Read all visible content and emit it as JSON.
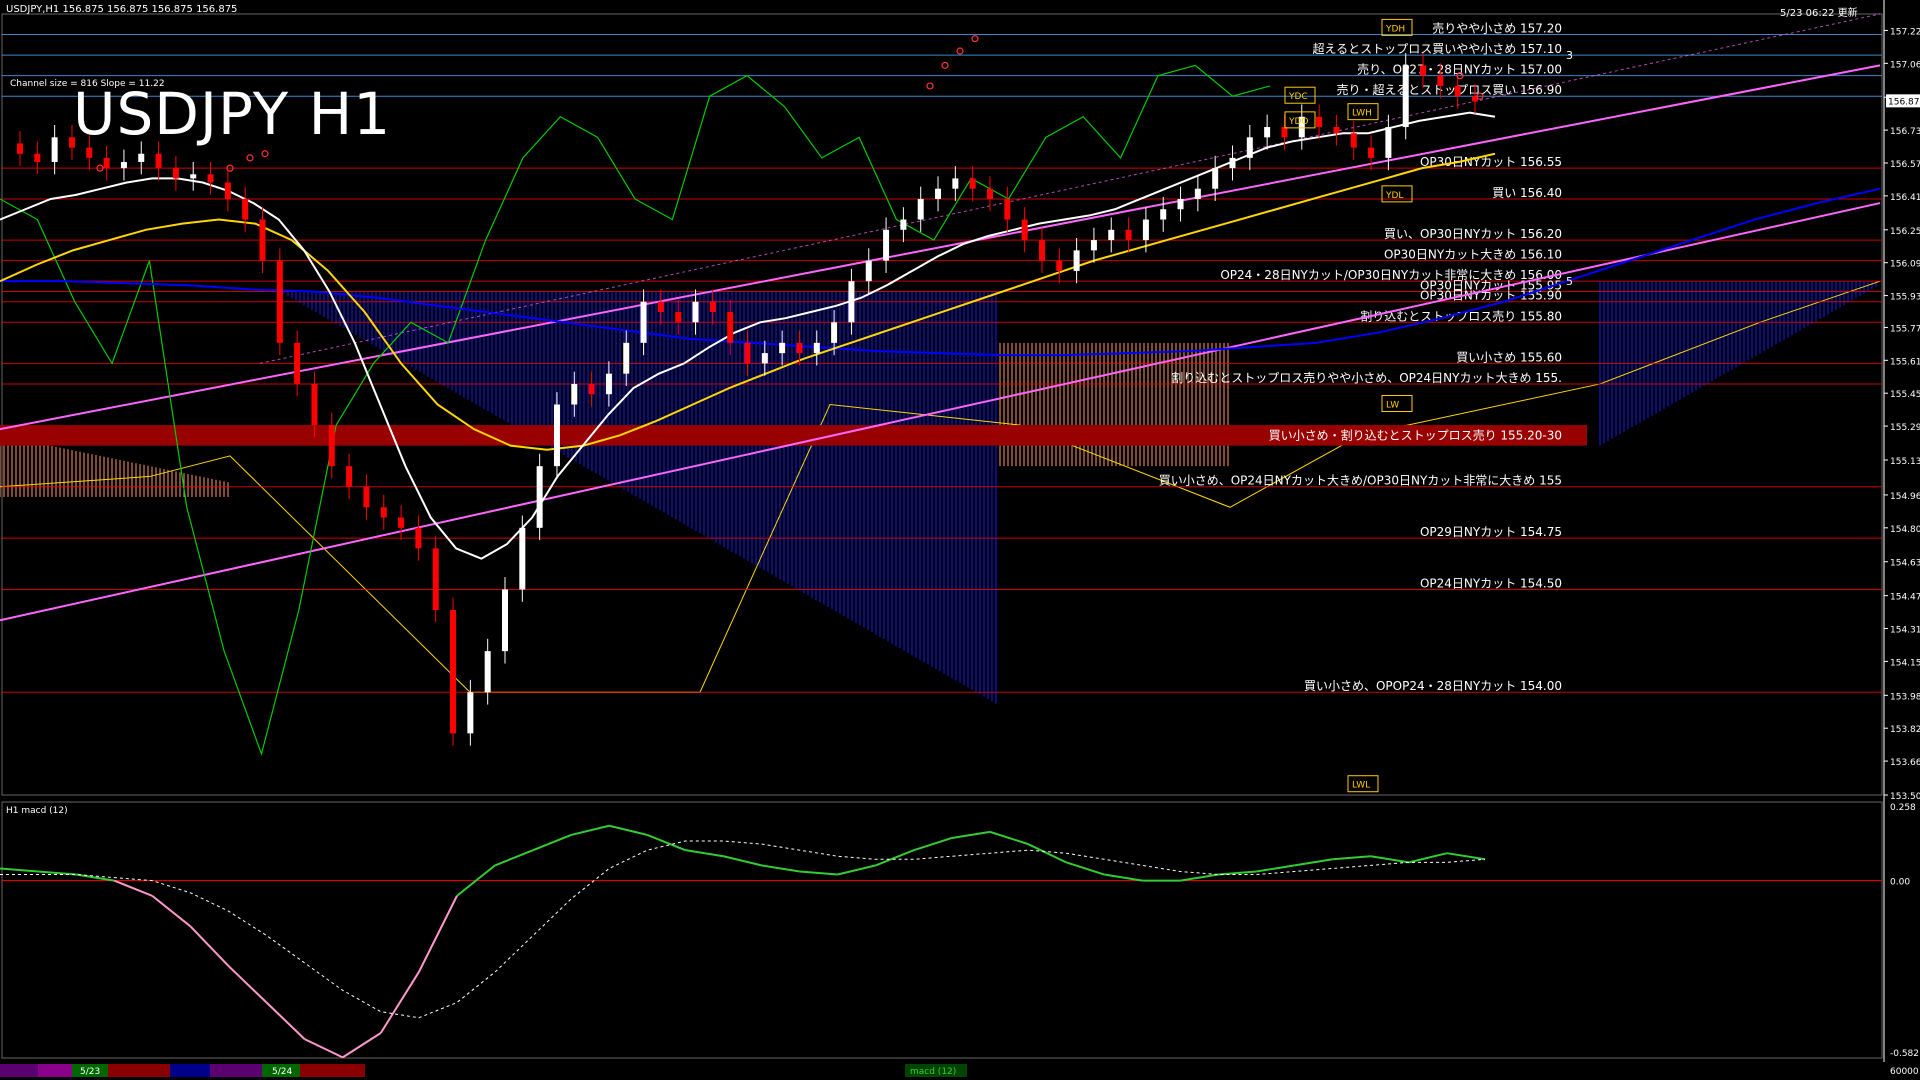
{
  "header": {
    "symbol_info": "USDJPY,H1  156.875 156.875 156.875 156.875",
    "updated": "5/23 06:22 更新",
    "channel_info": "Channel size = 816 Slope = 11.22"
  },
  "title": "USDJPY H1",
  "price_axis": {
    "labels": [
      "157.220",
      "157.060",
      "156.895",
      "156.735",
      "156.575",
      "156.415",
      "156.250",
      "156.090",
      "155.930",
      "155.775",
      "155.615",
      "155.455",
      "155.295",
      "155.130",
      "154.960",
      "154.800",
      "154.635",
      "154.470",
      "154.310",
      "154.150",
      "153.985",
      "153.825",
      "153.665",
      "153.500"
    ],
    "current": "156.875"
  },
  "colors": {
    "resistance_line": "#ff0000",
    "info_line": "#4da6ff",
    "channel": "#ff66ff",
    "sma_fast": "#ffffff",
    "sma_mid": "#ffd700",
    "sma_slow": "#0000ff",
    "chikou": "#00cc00",
    "cloud_bull": "#1a1aff",
    "cloud_bear": "#ff9966",
    "macd_main": "#33cc33",
    "macd_neg": "#ff99cc"
  },
  "chart_data": {
    "type": "candlestick",
    "symbol": "USDJPY",
    "timeframe": "H1",
    "ylim": [
      153.5,
      157.3
    ],
    "levels": [
      {
        "price": 157.2,
        "label": "売りやや小さめ 157.20",
        "color": "info"
      },
      {
        "price": 157.1,
        "label": "超えるとストップロス買いやや小さめ 157.10",
        "color": "info"
      },
      {
        "price": 157.0,
        "label": "売り、OP27・28日NYカット 157.00",
        "color": "info"
      },
      {
        "price": 156.9,
        "label": "売り・超えるとストップロス買い 156.90",
        "color": "info"
      },
      {
        "price": 156.55,
        "label": "OP30日NYカット 156.55",
        "color": "res"
      },
      {
        "price": 156.4,
        "label": "買い 156.40",
        "color": "res"
      },
      {
        "price": 156.2,
        "label": "買い、OP30日NYカット 156.20",
        "color": "res"
      },
      {
        "price": 156.1,
        "label": "OP30日NYカット大きめ 156.10",
        "color": "res"
      },
      {
        "price": 156.0,
        "label": "OP24・28日NYカット/OP30日NYカット非常に大きめ 156.00",
        "color": "res"
      },
      {
        "price": 155.95,
        "label": "OP30日NYカット 155.95",
        "color": "res"
      },
      {
        "price": 155.9,
        "label": "OP30日NYカット 155.90",
        "color": "res"
      },
      {
        "price": 155.8,
        "label": "割り込むとストップロス売り 155.80",
        "color": "res"
      },
      {
        "price": 155.6,
        "label": "買い小さめ 155.60",
        "color": "res"
      },
      {
        "price": 155.5,
        "label": "割り込むとストップロス売りやや小さめ、OP24日NYカット大きめ 155.",
        "color": "res"
      },
      {
        "price": 155.0,
        "label": "買い小さめ、OP24日NYカット大きめ/OP30日NYカット非常に大きめ 155",
        "color": "res"
      },
      {
        "price": 154.75,
        "label": "OP29日NYカット 154.75",
        "color": "res"
      },
      {
        "price": 154.5,
        "label": "OP24日NYカット 154.50",
        "color": "res"
      },
      {
        "price": 154.0,
        "label": "買い小さめ、OPOP24・28日NYカット 154.00",
        "color": "res"
      }
    ],
    "zone": {
      "from": 155.2,
      "to": 155.3,
      "label": "買い小さめ・割り込むとストップロス売り 155.20-30"
    },
    "markers": [
      "YDH",
      "YDC",
      "YDO",
      "LWH",
      "YDL",
      "LWL",
      "LW"
    ],
    "side_numbers": [
      "3",
      "5"
    ],
    "closes": [
      156.62,
      156.58,
      156.7,
      156.65,
      156.6,
      156.55,
      156.58,
      156.62,
      156.55,
      156.5,
      156.52,
      156.48,
      156.4,
      156.3,
      156.1,
      155.7,
      155.5,
      155.3,
      155.1,
      155.0,
      154.9,
      154.85,
      154.8,
      154.7,
      154.4,
      153.8,
      154.0,
      154.2,
      154.5,
      154.8,
      155.1,
      155.4,
      155.5,
      155.45,
      155.55,
      155.7,
      155.9,
      155.85,
      155.8,
      155.9,
      155.85,
      155.7,
      155.6,
      155.65,
      155.7,
      155.65,
      155.7,
      155.8,
      156.0,
      156.1,
      156.25,
      156.3,
      156.4,
      156.45,
      156.5,
      156.45,
      156.4,
      156.3,
      156.2,
      156.1,
      156.05,
      156.15,
      156.2,
      156.25,
      156.2,
      156.3,
      156.35,
      156.4,
      156.45,
      156.55,
      156.6,
      156.7,
      156.75,
      156.7,
      156.8,
      156.75,
      156.72,
      156.65,
      156.6,
      156.75,
      157.05,
      157.0,
      156.95,
      156.9,
      156.875
    ],
    "sma_fast": [
      156.3,
      156.35,
      156.4,
      156.42,
      156.45,
      156.48,
      156.5,
      156.5,
      156.48,
      156.44,
      156.38,
      156.3,
      156.15,
      155.95,
      155.7,
      155.4,
      155.1,
      154.85,
      154.7,
      154.65,
      154.72,
      154.85,
      155.05,
      155.2,
      155.35,
      155.48,
      155.55,
      155.6,
      155.68,
      155.75,
      155.8,
      155.82,
      155.85,
      155.88,
      155.92,
      155.98,
      156.05,
      156.12,
      156.18,
      156.22,
      156.25,
      156.28,
      156.3,
      156.32,
      156.35,
      156.4,
      156.45,
      156.5,
      156.55,
      156.6,
      156.65,
      156.68,
      156.7,
      156.72,
      156.72,
      156.75,
      156.78,
      156.8,
      156.82,
      156.8
    ],
    "sma_mid": [
      156.0,
      156.08,
      156.15,
      156.2,
      156.25,
      156.28,
      156.3,
      156.28,
      156.2,
      156.05,
      155.85,
      155.6,
      155.4,
      155.28,
      155.2,
      155.18,
      155.2,
      155.25,
      155.32,
      155.4,
      155.48,
      155.55,
      155.62,
      155.68,
      155.74,
      155.8,
      155.86,
      155.92,
      155.98,
      156.04,
      156.1,
      156.15,
      156.2,
      156.25,
      156.3,
      156.35,
      156.4,
      156.45,
      156.5,
      156.55,
      156.58,
      156.62
    ],
    "sma_slow": [
      156.0,
      156.0,
      155.99,
      155.98,
      155.96,
      155.95,
      155.92,
      155.88,
      155.84,
      155.8,
      155.76,
      155.72,
      155.7,
      155.68,
      155.66,
      155.65,
      155.64,
      155.64,
      155.65,
      155.66,
      155.68,
      155.7,
      155.75,
      155.82,
      155.9,
      156.0,
      156.1,
      156.2,
      156.3,
      156.38,
      156.45
    ],
    "macd": {
      "label": "H1 macd (12)",
      "ylim": [
        -0.582,
        0.258
      ],
      "zero": 0.0,
      "main": [
        0.04,
        0.03,
        0.02,
        0.0,
        -0.05,
        -0.15,
        -0.28,
        -0.4,
        -0.52,
        -0.58,
        -0.5,
        -0.3,
        -0.05,
        0.05,
        0.1,
        0.15,
        0.18,
        0.15,
        0.1,
        0.08,
        0.05,
        0.03,
        0.02,
        0.05,
        0.1,
        0.14,
        0.16,
        0.12,
        0.06,
        0.02,
        0.0,
        0.0,
        0.02,
        0.03,
        0.05,
        0.07,
        0.08,
        0.06,
        0.09,
        0.07
      ],
      "signal": [
        0.02,
        0.02,
        0.02,
        0.01,
        0.0,
        -0.04,
        -0.1,
        -0.18,
        -0.27,
        -0.36,
        -0.43,
        -0.45,
        -0.4,
        -0.3,
        -0.18,
        -0.06,
        0.04,
        0.1,
        0.13,
        0.13,
        0.12,
        0.1,
        0.08,
        0.07,
        0.07,
        0.08,
        0.09,
        0.1,
        0.09,
        0.07,
        0.05,
        0.03,
        0.02,
        0.02,
        0.03,
        0.04,
        0.05,
        0.06,
        0.06,
        0.07
      ]
    }
  },
  "macd_axis": {
    "top": "0.258",
    "zero": "0.00",
    "bottom": "-0.582"
  },
  "timebar": {
    "dates": [
      "5/23",
      "5/24"
    ],
    "indicator": "macd (12)",
    "volume": "60000"
  }
}
